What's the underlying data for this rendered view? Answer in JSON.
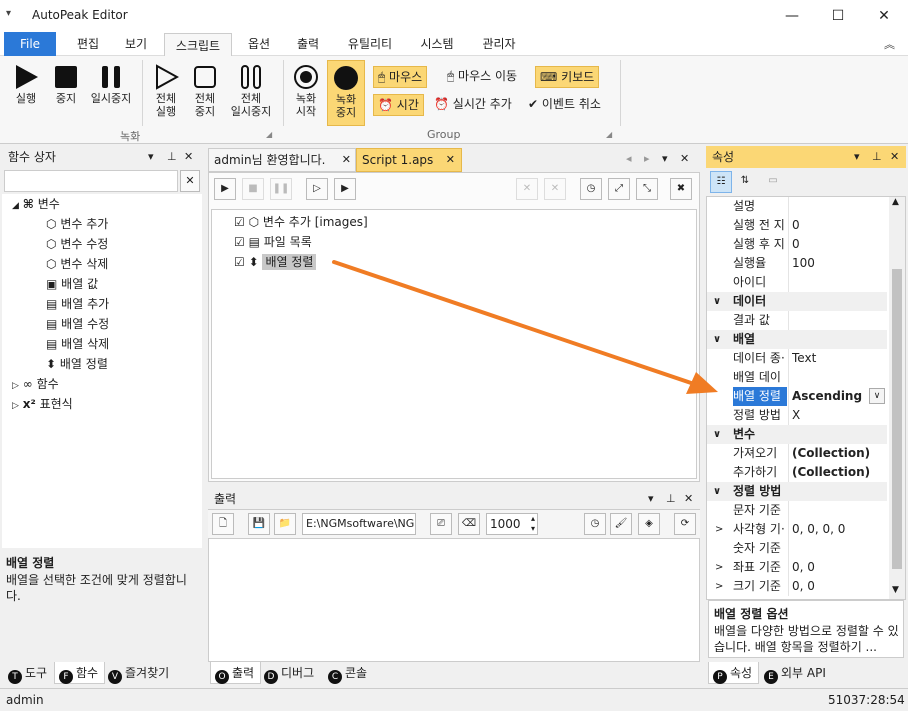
{
  "window": {
    "title": "AutoPeak Editor",
    "menu_glyph": "▾",
    "minimize": "—",
    "maximize": "☐",
    "close": "✕"
  },
  "ribbon_tabs": [
    "File",
    "편집",
    "보기",
    "스크립트",
    "옵션",
    "출력",
    "유틸리티",
    "시스템",
    "관리자"
  ],
  "ribbon_collapse": "︽",
  "ribbon": {
    "run": "실행",
    "stop": "중지",
    "pause": "일시중지",
    "all_run": [
      "전체",
      "실행"
    ],
    "all_stop": [
      "전체",
      "중지"
    ],
    "all_pause": [
      "전체",
      "일시중지"
    ],
    "group_record": "녹화",
    "rec_start": [
      "녹화",
      "시작"
    ],
    "rec_stop": [
      "녹화",
      "중지"
    ],
    "mouse": "마우스",
    "mouse_move": "마우스 이동",
    "keyboard": "키보드",
    "time": "시간",
    "realtime_add": "실시간 추가",
    "event_cancel": "이벤트 취소",
    "group_group": "Group"
  },
  "left_panel": {
    "title": "함수 상자",
    "search_clear": "✕",
    "tree": {
      "variables": "변수",
      "var_add": "변수 추가",
      "var_edit": "변수 수정",
      "var_delete": "변수 삭제",
      "arr_value": "배열 값",
      "arr_add": "배열 추가",
      "arr_edit": "배열 수정",
      "arr_delete": "배열 삭제",
      "arr_sort": "배열 정렬",
      "functions": "함수",
      "expressions": "표현식"
    },
    "desc_title": "배열 정렬",
    "desc_text": "배열을 선택한 조건에 맞게 정렬합니다.",
    "bottom_tabs": [
      {
        "key": "T",
        "label": "도구"
      },
      {
        "key": "F",
        "label": "함수"
      },
      {
        "key": "V",
        "label": "즐겨찾기"
      }
    ]
  },
  "editor": {
    "tab_welcome": "admin님 환영합니다.",
    "tab_script": "Script 1.aps",
    "items": [
      {
        "label": "변수 추가 [images]"
      },
      {
        "label": "파일 목록"
      },
      {
        "label": "배열 정렬"
      }
    ]
  },
  "output": {
    "title": "출력",
    "path": "E:\\NGMsoftware\\NG",
    "count": "1000",
    "bottom_tabs": [
      {
        "key": "O",
        "label": "출력"
      },
      {
        "key": "D",
        "label": "디버그"
      },
      {
        "key": "C",
        "label": "콘솔"
      }
    ]
  },
  "properties": {
    "title": "속성",
    "rows": [
      {
        "type": "prop",
        "name": "설명",
        "value": ""
      },
      {
        "type": "prop",
        "name": "실행 전 지",
        "value": "0"
      },
      {
        "type": "prop",
        "name": "실행 후 지",
        "value": "0"
      },
      {
        "type": "prop",
        "name": "실행율",
        "value": "100"
      },
      {
        "type": "prop",
        "name": "아이디",
        "value": ""
      },
      {
        "type": "cat",
        "name": "데이터"
      },
      {
        "type": "prop",
        "name": "결과 값",
        "value": ""
      },
      {
        "type": "cat",
        "name": "배열"
      },
      {
        "type": "prop",
        "name": "데이터 종·",
        "value": "Text"
      },
      {
        "type": "prop",
        "name": "배열 데이",
        "value": ""
      },
      {
        "type": "prop",
        "name": "배열 정렬",
        "value": "Ascending",
        "selected": true
      },
      {
        "type": "prop",
        "name": "정렬 방법",
        "value": "X"
      },
      {
        "type": "cat",
        "name": "변수"
      },
      {
        "type": "prop",
        "name": "가져오기",
        "value": "(Collection)",
        "bold": true
      },
      {
        "type": "prop",
        "name": "추가하기",
        "value": "(Collection)",
        "bold": true
      },
      {
        "type": "cat",
        "name": "정렬 방법"
      },
      {
        "type": "prop",
        "name": "문자 기준",
        "value": ""
      },
      {
        "type": "prop",
        "name": "사각형 기·",
        "value": "0, 0, 0, 0",
        "expand": true
      },
      {
        "type": "prop",
        "name": "숫자 기준",
        "value": ""
      },
      {
        "type": "prop",
        "name": "좌표 기준",
        "value": "0, 0",
        "expand": true
      },
      {
        "type": "prop",
        "name": "크기 기준",
        "value": "0, 0",
        "expand": true
      }
    ],
    "desc_title": "배열 정렬 옵션",
    "desc_text": "배열을 다양한 방법으로 정렬할 수 있습니다. 배열 항목을 정렬하기 ...",
    "bottom_tabs": [
      {
        "key": "P",
        "label": "속성"
      },
      {
        "key": "E",
        "label": "외부 API"
      }
    ]
  },
  "status": {
    "user": "admin",
    "time": "51037:28:54"
  },
  "colors": {
    "accent": "#2b79d8",
    "highlight": "#fbd775",
    "arrow": "#f07c24"
  }
}
